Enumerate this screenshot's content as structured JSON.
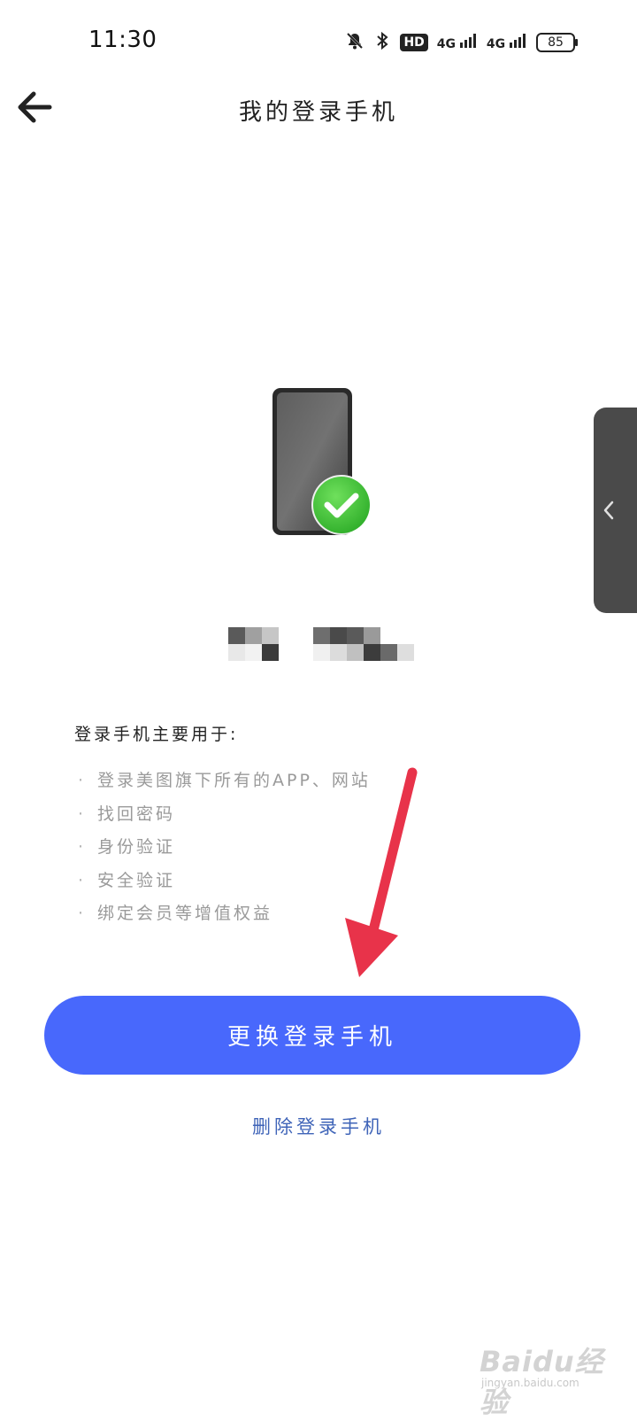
{
  "status_bar": {
    "time": "11:30",
    "hd_label": "HD",
    "signal1": "4G",
    "signal2": "4G",
    "battery": "85",
    "icons": [
      "mute-bell-icon",
      "bluetooth-icon",
      "hd-icon",
      "signal-4g-icon",
      "signal-4g-icon",
      "battery-icon"
    ]
  },
  "header": {
    "back_icon": "back-arrow-icon",
    "title": "我的登录手机"
  },
  "illustration": {
    "icon": "phone-verified-icon",
    "check_color": "#3fbf3a"
  },
  "usage": {
    "title": "登录手机主要用于:",
    "items": [
      "登录美图旗下所有的APP、网站",
      "找回密码",
      "身份验证",
      "安全验证",
      "绑定会员等增值权益"
    ]
  },
  "actions": {
    "change_label": "更换登录手机",
    "delete_label": "删除登录手机",
    "accent_color": "#4868fc",
    "link_color": "#3f64b8"
  },
  "side_handle": {
    "icon": "chevron-left-icon"
  },
  "watermark": {
    "main": "Baidu经验",
    "sub": "jingyan.baidu.com"
  }
}
